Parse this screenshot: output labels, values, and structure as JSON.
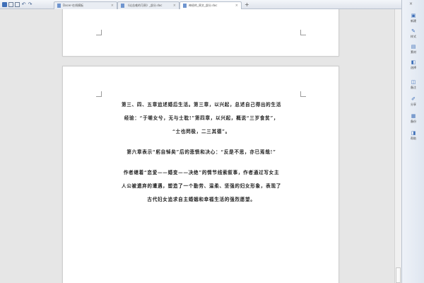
{
  "tabs": [
    {
      "label": "Docer-在线模板",
      "close": "×"
    },
    {
      "label": "《论苦难的可贵》_部分.doc",
      "close": "×"
    },
    {
      "label": "神经的_原文_部分.doc",
      "close": "×"
    }
  ],
  "tab_add": "+",
  "document": {
    "paragraphs": [
      [
        "第三、四、五章追述婚后生活。第三章，以兴起，总述自己得出的生活",
        "经验：“于嗟女兮，无与士耽!”第四章，以兴起，概说“三岁食贫”，",
        "“士也罔极，二三其德”。"
      ],
      [
        "第六章表示“躬自悼矣”后的悲愤和决心：“反是不思，亦已焉哉!”"
      ],
      [
        "作者继着“恋爱——婚变——决绝”的情节线索叙事，作者通过写女主",
        "人公被遗弃的遭遇，塑造了一个勤劳、温柔、坚强的妇女形象，表现了",
        "古代妇女追求自主婚姻和幸福生活的强烈愿望。"
      ]
    ]
  },
  "task_pane": {
    "close": "×",
    "items": [
      {
        "icon": "new-icon",
        "label": "新建"
      },
      {
        "icon": "format-icon",
        "label": "样式"
      },
      {
        "icon": "clip-icon",
        "label": "素材"
      },
      {
        "icon": "select-icon",
        "label": "选择"
      },
      {
        "icon": "backup-icon",
        "label": "备注"
      },
      {
        "icon": "share-icon",
        "label": "分享"
      },
      {
        "icon": "backup2-icon",
        "label": "备份"
      },
      {
        "icon": "help-icon",
        "label": "帮助"
      }
    ]
  }
}
